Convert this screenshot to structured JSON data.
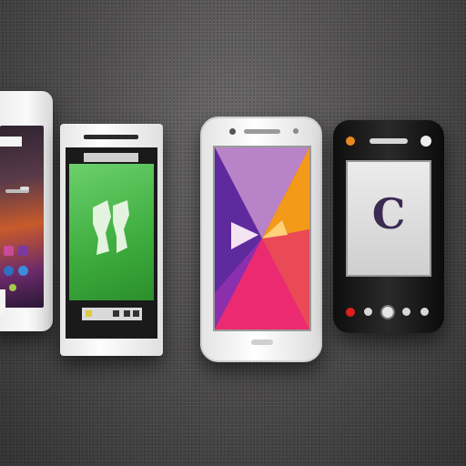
{
  "phones": [
    {
      "id": "phone-left-white",
      "color": "#f2f2f2"
    },
    {
      "id": "phone-green-screen",
      "color": "#ededed",
      "screen_color": "#4cbf4c"
    },
    {
      "id": "phone-center-white",
      "color": "#f7f7f7"
    },
    {
      "id": "phone-right-black",
      "color": "#1a1a1a",
      "screen_text": "C"
    }
  ],
  "icons": [
    "speaker-icon",
    "camera-icon",
    "home-button-icon",
    "power-led-icon"
  ]
}
